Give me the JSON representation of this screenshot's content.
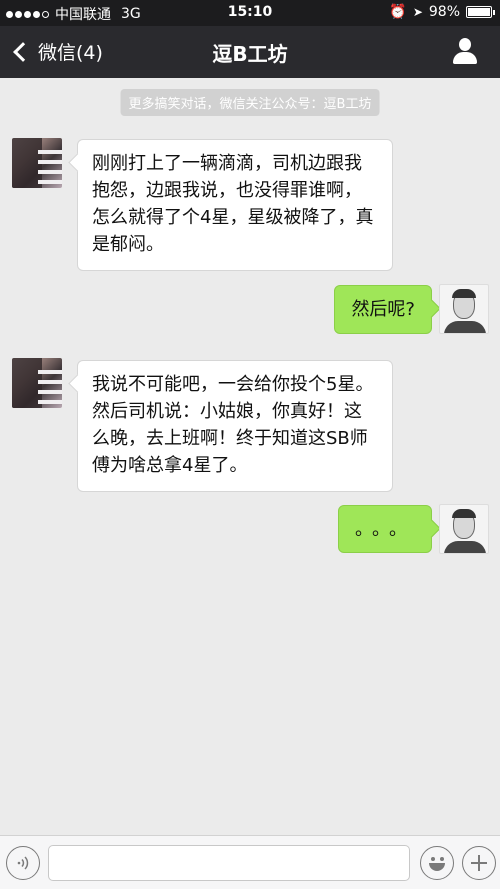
{
  "status_bar": {
    "carrier": "中国联通",
    "network": "3G",
    "time": "15:10",
    "battery": "98%",
    "battery_level": 0.98
  },
  "nav": {
    "back_label": "微信(4)",
    "title": "逗B工坊"
  },
  "system_notice": "更多搞笑对话，微信关注公众号：逗B工坊",
  "messages": [
    {
      "side": "left",
      "text": "刚刚打上了一辆滴滴，司机边跟我抱怨，边跟我说，也没得罪谁啊，怎么就得了个4星，星级被降了，真是郁闷。"
    },
    {
      "side": "right",
      "text": "然后呢?"
    },
    {
      "side": "left",
      "text": "我说不可能吧，一会给你投个5星。然后司机说：小姑娘，你真好！这么晚，去上班啊！终于知道这SB师傅为啥总拿4星了。"
    },
    {
      "side": "right",
      "text": "。。。"
    }
  ],
  "input": {
    "value": "",
    "placeholder": ""
  },
  "icons": {
    "back": "chevron-left-icon",
    "profile": "person-icon",
    "voice": "voice-icon",
    "emoji": "emoji-icon",
    "plus": "plus-icon"
  },
  "colors": {
    "nav_bg": "#2a2a2e",
    "chat_bg": "#ebebeb",
    "my_bubble": "#9fe658",
    "their_bubble": "#ffffff"
  }
}
